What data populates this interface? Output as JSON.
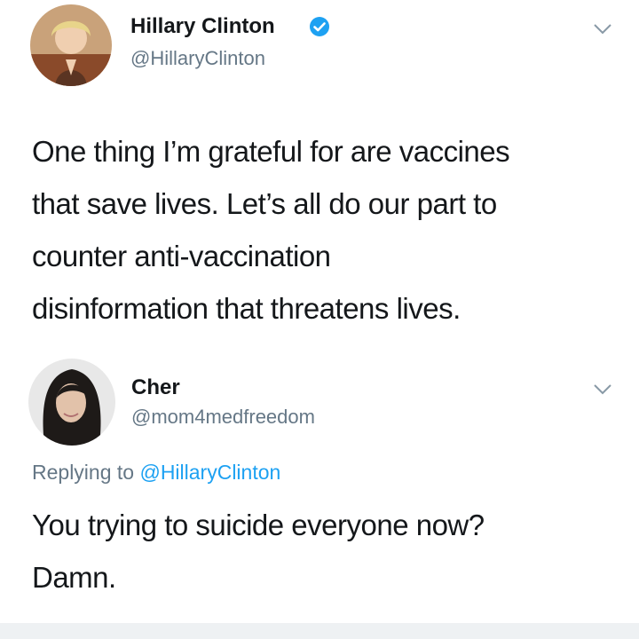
{
  "tweet": {
    "author_name": "Hillary Clinton",
    "author_handle": "@HillaryClinton",
    "verified": true,
    "text_lines": [
      "One thing I’m grateful for are vaccines",
      "that save lives. Let’s all do our part to",
      "counter anti-vaccination",
      "disinformation that threatens lives."
    ]
  },
  "reply": {
    "author_name": "Cher",
    "author_handle": "@mom4medfreedom",
    "replying_prefix": "Replying to",
    "replying_to": "@HillaryClinton",
    "text_lines": [
      "You trying to suicide everyone now?",
      "Damn."
    ]
  },
  "colors": {
    "verified_blue": "#1da1f2",
    "handle_gray": "#657786",
    "text_dark": "#14171a"
  },
  "icons": {
    "verified": "verified-badge-icon",
    "more": "chevron-down-icon"
  }
}
